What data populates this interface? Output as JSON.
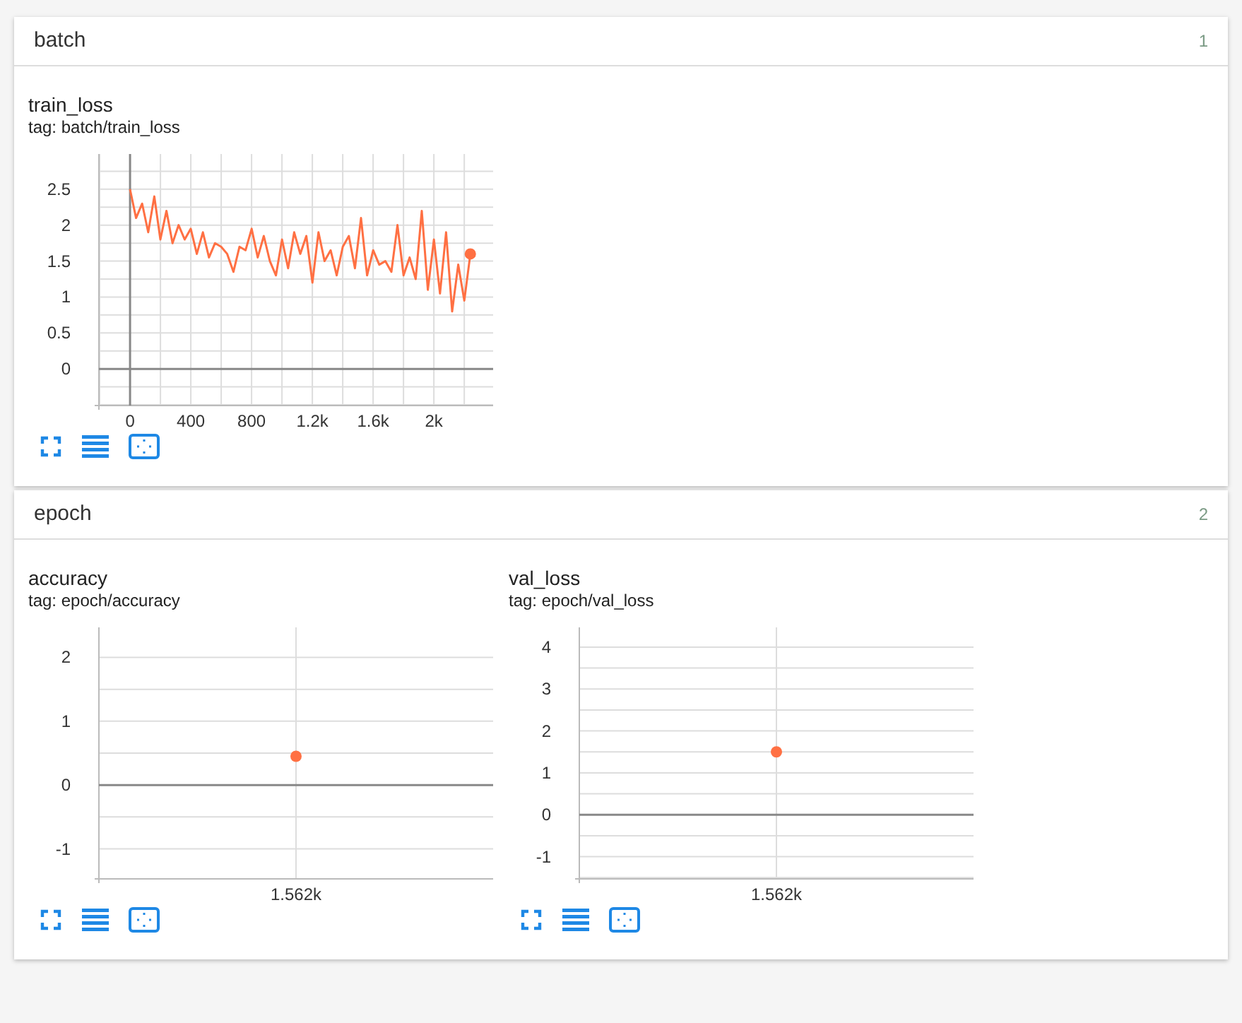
{
  "sections": [
    {
      "title": "batch",
      "count": "1",
      "cards": [
        {
          "title": "train_loss",
          "tag": "tag: batch/train_loss",
          "chart_data": {
            "type": "line",
            "x": [
              0,
              40,
              80,
              120,
              160,
              200,
              240,
              280,
              320,
              360,
              400,
              440,
              480,
              520,
              560,
              600,
              640,
              680,
              720,
              760,
              800,
              840,
              880,
              920,
              960,
              1000,
              1040,
              1080,
              1120,
              1160,
              1200,
              1240,
              1280,
              1320,
              1360,
              1400,
              1440,
              1480,
              1520,
              1560,
              1600,
              1640,
              1680,
              1720,
              1760,
              1800,
              1840,
              1880,
              1920,
              1960,
              2000,
              2040,
              2080,
              2120,
              2160,
              2200,
              2240
            ],
            "grid": true,
            "series": [
              {
                "color": "#ff7043",
                "values": [
                  2.5,
                  2.1,
                  2.3,
                  1.9,
                  2.4,
                  1.8,
                  2.2,
                  1.75,
                  2.0,
                  1.8,
                  1.95,
                  1.6,
                  1.9,
                  1.55,
                  1.75,
                  1.7,
                  1.6,
                  1.35,
                  1.7,
                  1.65,
                  1.95,
                  1.55,
                  1.85,
                  1.5,
                  1.3,
                  1.8,
                  1.4,
                  1.9,
                  1.6,
                  1.85,
                  1.2,
                  1.9,
                  1.5,
                  1.65,
                  1.3,
                  1.7,
                  1.85,
                  1.4,
                  2.1,
                  1.3,
                  1.65,
                  1.45,
                  1.5,
                  1.35,
                  2.0,
                  1.3,
                  1.55,
                  1.25,
                  2.2,
                  1.1,
                  1.8,
                  1.05,
                  1.9,
                  0.8,
                  1.45,
                  0.95,
                  1.6
                ]
              }
            ],
            "xlim": [
              -205,
              2390
            ],
            "ylim": [
              -0.51,
              2.99
            ],
            "xticks": [
              0,
              400,
              800,
              {
                "value": 1200,
                "label": "1.2k"
              },
              {
                "value": 1600,
                "label": "1.6k"
              },
              {
                "value": 2000,
                "label": "2k"
              }
            ],
            "yticks": [
              0,
              0.5,
              1,
              1.5,
              2,
              2.5
            ]
          }
        }
      ]
    },
    {
      "title": "epoch",
      "count": "2",
      "cards": [
        {
          "title": "accuracy",
          "tag": "tag: epoch/accuracy",
          "chart_data": {
            "type": "line",
            "grid": true,
            "categories": [
              "1.562k"
            ],
            "series": [
              {
                "color": "#ff7043",
                "marker": true,
                "values": [
                  0.45
                ]
              }
            ],
            "ylim": [
              -1.47,
              2.47
            ],
            "yticks": [
              -1,
              0,
              1,
              2
            ]
          }
        },
        {
          "title": "val_loss",
          "tag": "tag: epoch/val_loss",
          "chart_data": {
            "type": "line",
            "grid": true,
            "categories": [
              "1.562k"
            ],
            "series": [
              {
                "color": "#ff7043",
                "marker": true,
                "values": [
                  1.5
                ]
              }
            ],
            "ylim": [
              -1.53,
              4.47
            ],
            "yticks": [
              -1,
              0,
              1,
              2,
              3,
              4
            ]
          }
        }
      ]
    }
  ]
}
